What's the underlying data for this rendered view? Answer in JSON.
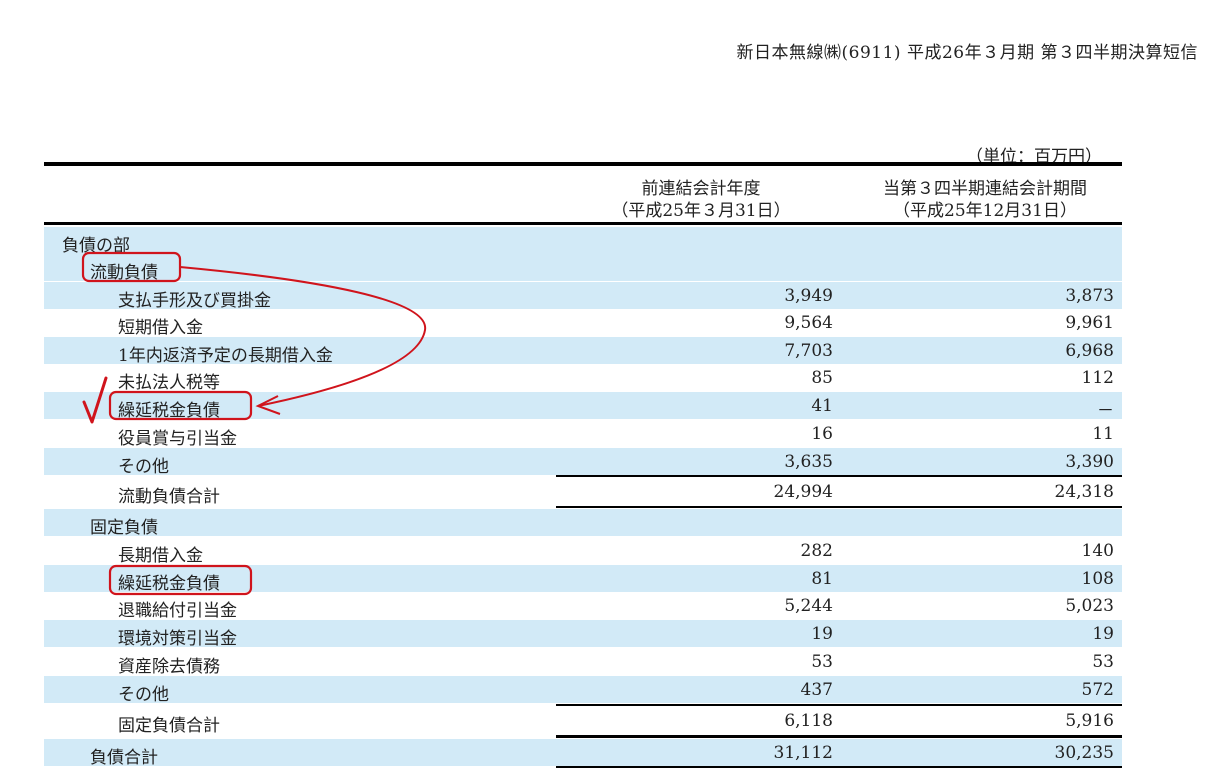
{
  "header": {
    "title": "新日本無線㈱(6911) 平成26年３月期 第３四半期決算短信"
  },
  "unit": "（単位：百万円）",
  "columns": {
    "prev": [
      "前連結会計年度",
      "（平成25年３月31日）"
    ],
    "curr": [
      "当第３四半期連結会計期間",
      "（平成25年12月31日）"
    ]
  },
  "rows": [
    {
      "label": "負債の部",
      "v1": "",
      "v2": ""
    },
    {
      "label": "流動負債",
      "v1": "",
      "v2": ""
    },
    {
      "label": "支払手形及び買掛金",
      "v1": "3,949",
      "v2": "3,873"
    },
    {
      "label": "短期借入金",
      "v1": "9,564",
      "v2": "9,961"
    },
    {
      "label": "1年内返済予定の長期借入金",
      "v1": "7,703",
      "v2": "6,968"
    },
    {
      "label": "未払法人税等",
      "v1": "85",
      "v2": "112"
    },
    {
      "label": "繰延税金負債",
      "v1": "41",
      "v2": "－"
    },
    {
      "label": "役員賞与引当金",
      "v1": "16",
      "v2": "11"
    },
    {
      "label": "その他",
      "v1": "3,635",
      "v2": "3,390"
    },
    {
      "label": "流動負債合計",
      "v1": "24,994",
      "v2": "24,318"
    },
    {
      "label": "固定負債",
      "v1": "",
      "v2": ""
    },
    {
      "label": "長期借入金",
      "v1": "282",
      "v2": "140"
    },
    {
      "label": "繰延税金負債",
      "v1": "81",
      "v2": "108"
    },
    {
      "label": "退職給付引当金",
      "v1": "5,244",
      "v2": "5,023"
    },
    {
      "label": "環境対策引当金",
      "v1": "19",
      "v2": "19"
    },
    {
      "label": "資産除去債務",
      "v1": "53",
      "v2": "53"
    },
    {
      "label": "その他",
      "v1": "437",
      "v2": "572"
    },
    {
      "label": "固定負債合計",
      "v1": "6,118",
      "v2": "5,916"
    },
    {
      "label": "負債合計",
      "v1": "31,112",
      "v2": "30,235"
    }
  ],
  "annotation_color": "#d0141c"
}
